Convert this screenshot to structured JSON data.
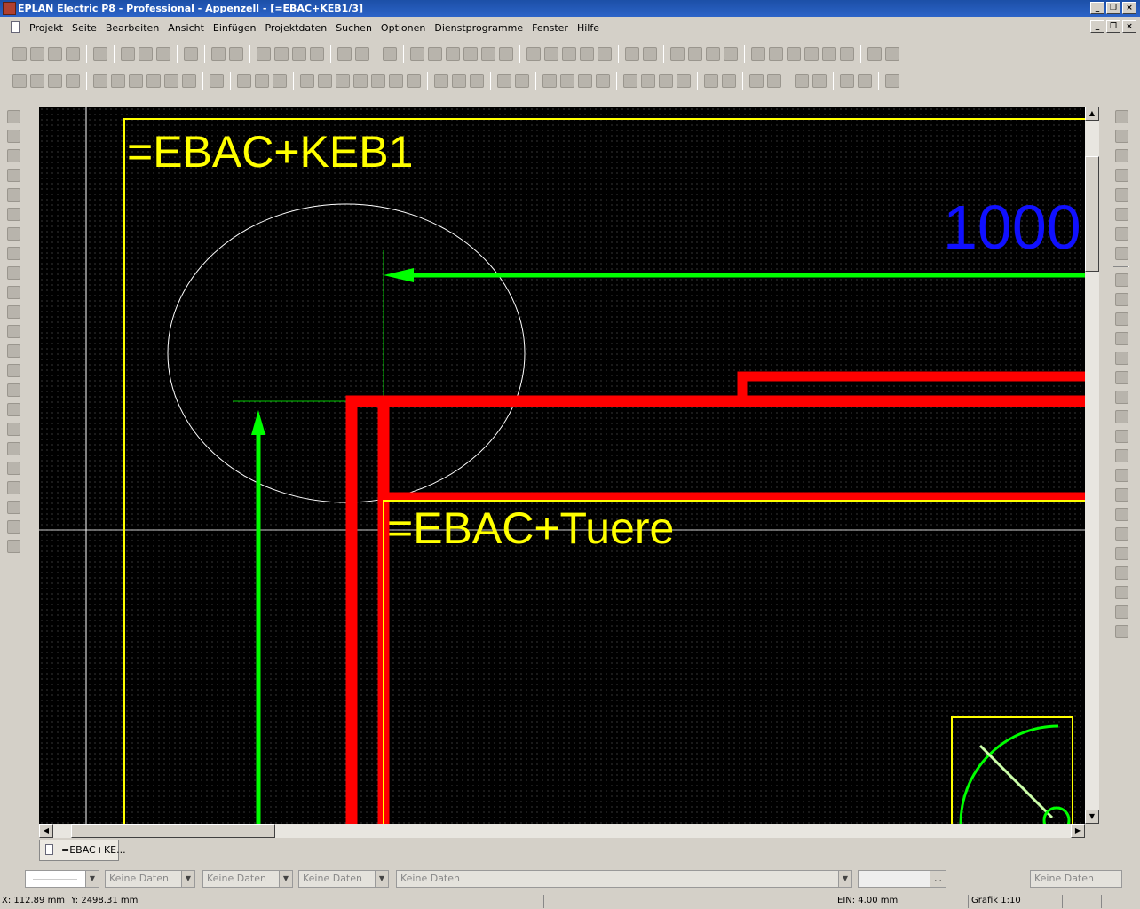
{
  "window": {
    "title": "EPLAN Electric P8 - Professional - Appenzell - [=EBAC+KEB1/3]"
  },
  "menu": [
    "Projekt",
    "Seite",
    "Bearbeiten",
    "Ansicht",
    "Einfügen",
    "Projektdaten",
    "Suchen",
    "Optionen",
    "Dienstprogramme",
    "Fenster",
    "Hilfe"
  ],
  "toolbar1": [
    "new-project-icon",
    "open-project-icon",
    "close-project-icon",
    "print-icon",
    "|",
    "settings-wrench-icon",
    "|",
    "cut-icon",
    "copy-icon",
    "paste-icon",
    "|",
    "delete-icon",
    "|",
    "check-icon",
    "check2-icon",
    "|",
    "undo-icon",
    "undo-list-icon",
    "redo-icon",
    "redo-list-icon",
    "|",
    "page-properties-icon",
    "table-icon",
    "|",
    "screen-icon",
    "|",
    "page-new-icon",
    "page-open-icon",
    "page-copy-icon",
    "page-up-icon",
    "page-prev-icon",
    "page-next-icon",
    "|",
    "refresh-icon",
    "circle-icon",
    "zoom-in-icon",
    "zoom-out-icon",
    "zoom-100-icon",
    "|",
    "nav-back-icon",
    "nav-forward-icon",
    "|",
    "grid-a-icon",
    "grid-b-icon",
    "grid-c-icon",
    "grid-d-icon",
    "|",
    "snap-grid-icon",
    "snap-point-icon",
    "snap-center-icon",
    "connect-icon",
    "align-icon",
    "macro-icon",
    "|",
    "tool-a-icon",
    "tool-b-icon"
  ],
  "toolbar2": [
    "line-icon",
    "polyline-icon",
    "polygon-icon",
    "rectangle-icon",
    "|",
    "circle-center-icon",
    "circle-3pt-icon",
    "arc-icon",
    "arc-3pt-icon",
    "sector-icon",
    "ellipse-icon",
    "|",
    "spline-icon",
    "|",
    "text-icon",
    "image-icon",
    "hyperlink-icon",
    "|",
    "dim-linear-icon",
    "dim-aligned-icon",
    "dim-chain-icon",
    "dim-incremental-icon",
    "dim-base-icon",
    "dim-angle-icon",
    "dim-radius-icon",
    "|",
    "trim-icon",
    "break-icon",
    "stretch-icon",
    "|",
    "pointer-icon",
    "insert-point-icon",
    "|",
    "corner-tl-icon",
    "corner-tr-icon",
    "corner-bl-icon",
    "corner-br-icon",
    "|",
    "tee-down-icon",
    "tee-right-icon",
    "tee-left-icon",
    "tee-up-icon",
    "|",
    "cross-icon",
    "cross2-icon",
    "|",
    "jump-icon",
    "diagonal-icon",
    "|",
    "terminal-icon",
    "connection-icon",
    "|",
    "cable-icon",
    "shield-icon",
    "|",
    "number-1-icon"
  ],
  "left_toolbar": [
    "navigator-icon",
    "page-icon",
    "device-icon",
    "terminal-strip-icon",
    "plug-icon",
    "cable-nav-icon",
    "pot-icon",
    "connection-nav-icon",
    "bus-icon",
    "plc-icon",
    "function-icon",
    "structure-icon",
    "assign-icon",
    "placeholder-icon",
    "macro-nav-icon",
    "graph-icon",
    "layer-icon",
    "print-nav-icon",
    "person-icon",
    "numbering-icon",
    "sort-icon",
    "order-icon",
    "parallel-icon"
  ],
  "right_toolbar": [
    "corner-icon",
    "tee-down-r-icon",
    "tee-right-r-icon",
    "tee-left-r-icon",
    "tee-up-r-icon",
    "arrow-right-icon",
    "arrow-right2-icon",
    "diag-icon",
    "|",
    "potential-icon",
    "connector-icon",
    "interrupt-icon",
    "cable-def-icon",
    "shield-r-icon",
    "terminal-r-icon",
    "terminal-multi-icon",
    "plug-r-icon",
    "pin-icon",
    "ground-icon",
    "bridge-icon",
    "splice-icon",
    "point-icon",
    "jumper-icon",
    "plc-r-icon",
    "bus-r-icon",
    "device-r-icon",
    "fuse-icon",
    "wire-icon"
  ],
  "drawing": {
    "label_keb1": "=EBAC+KEB1",
    "label_tuere": "=EBAC+Tuere",
    "label_1000": "1000",
    "colors": {
      "yellow": "#ffff00",
      "red": "#ff0000",
      "green": "#00ff00",
      "blue": "#1010ff",
      "white": "#ffffff"
    }
  },
  "tab": {
    "label": "=EBAC+KE..."
  },
  "properties": {
    "combo1": "Keine Daten",
    "combo2": "Keine Daten",
    "combo3": "Keine Daten",
    "combo4": "Keine Daten",
    "combo5": "Keine Daten"
  },
  "status": {
    "x": "X: 112.89 mm",
    "y": "Y: 2498.31 mm",
    "ein": "EIN: 4.00 mm",
    "grafik": "Grafik 1:10"
  }
}
